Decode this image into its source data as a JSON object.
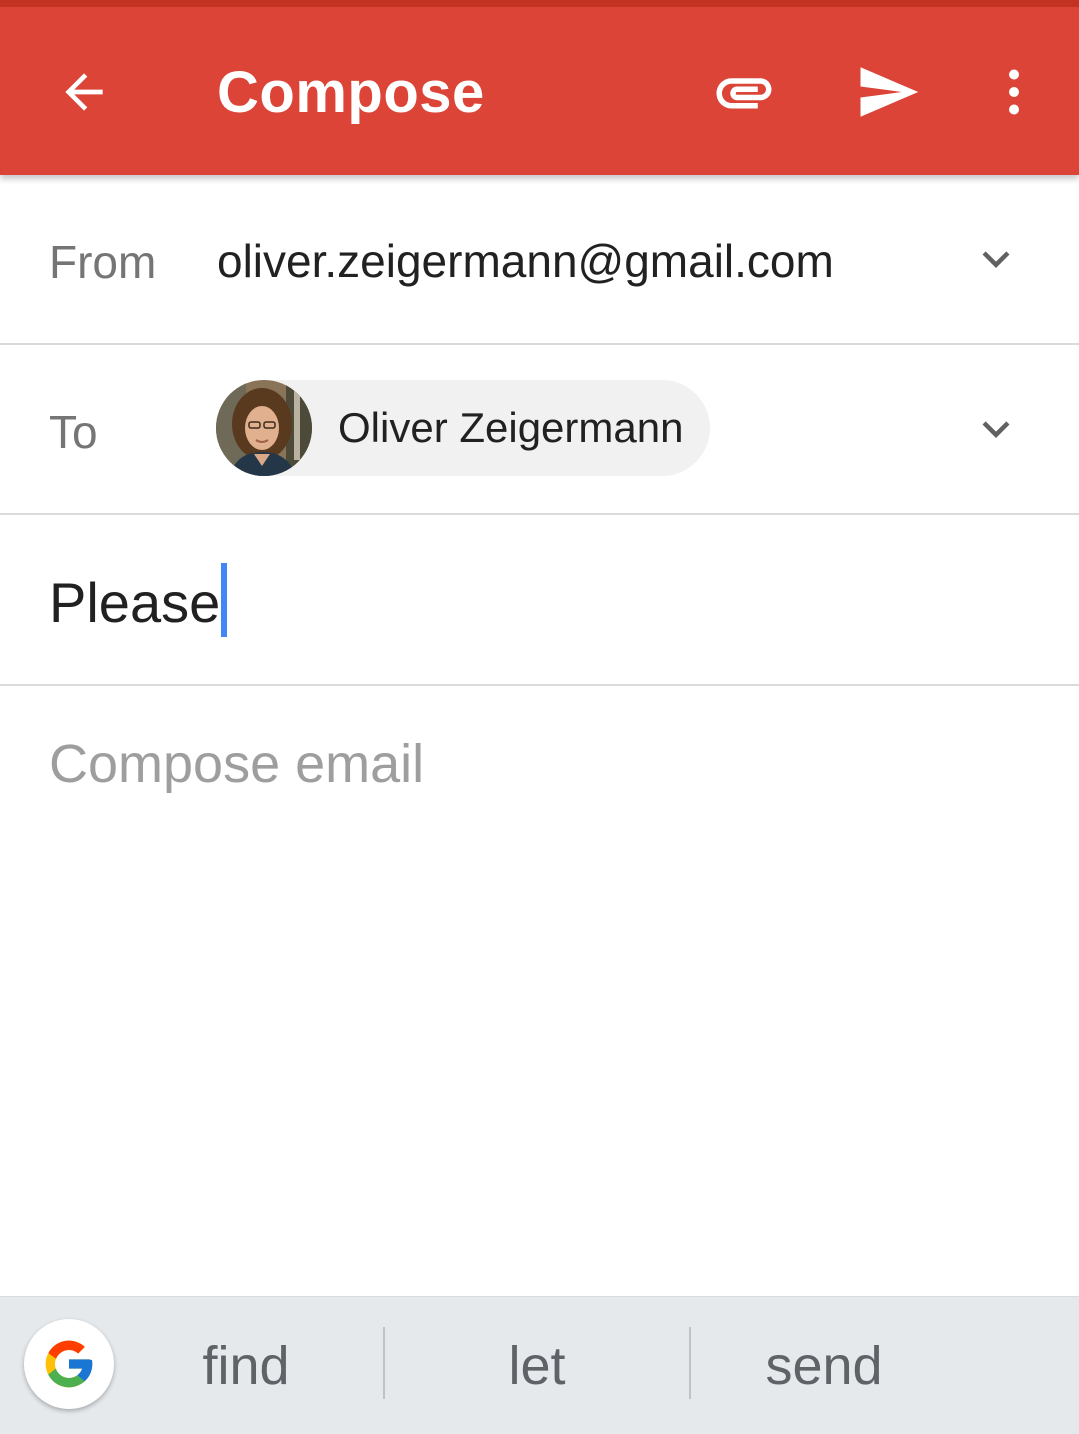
{
  "appbar": {
    "title": "Compose",
    "color": "#db4437",
    "icons": [
      "arrow-back-icon",
      "attachment-icon",
      "send-icon",
      "more-vert-icon"
    ]
  },
  "from": {
    "label": "From",
    "value": "oliver.zeigermann@gmail.com"
  },
  "to": {
    "label": "To",
    "recipient_name": "Oliver Zeigermann"
  },
  "subject": {
    "value": "Please"
  },
  "body": {
    "placeholder": "Compose email"
  },
  "suggestions": {
    "items": [
      "find",
      "let",
      "send"
    ],
    "google_icon": "google-g-icon"
  }
}
